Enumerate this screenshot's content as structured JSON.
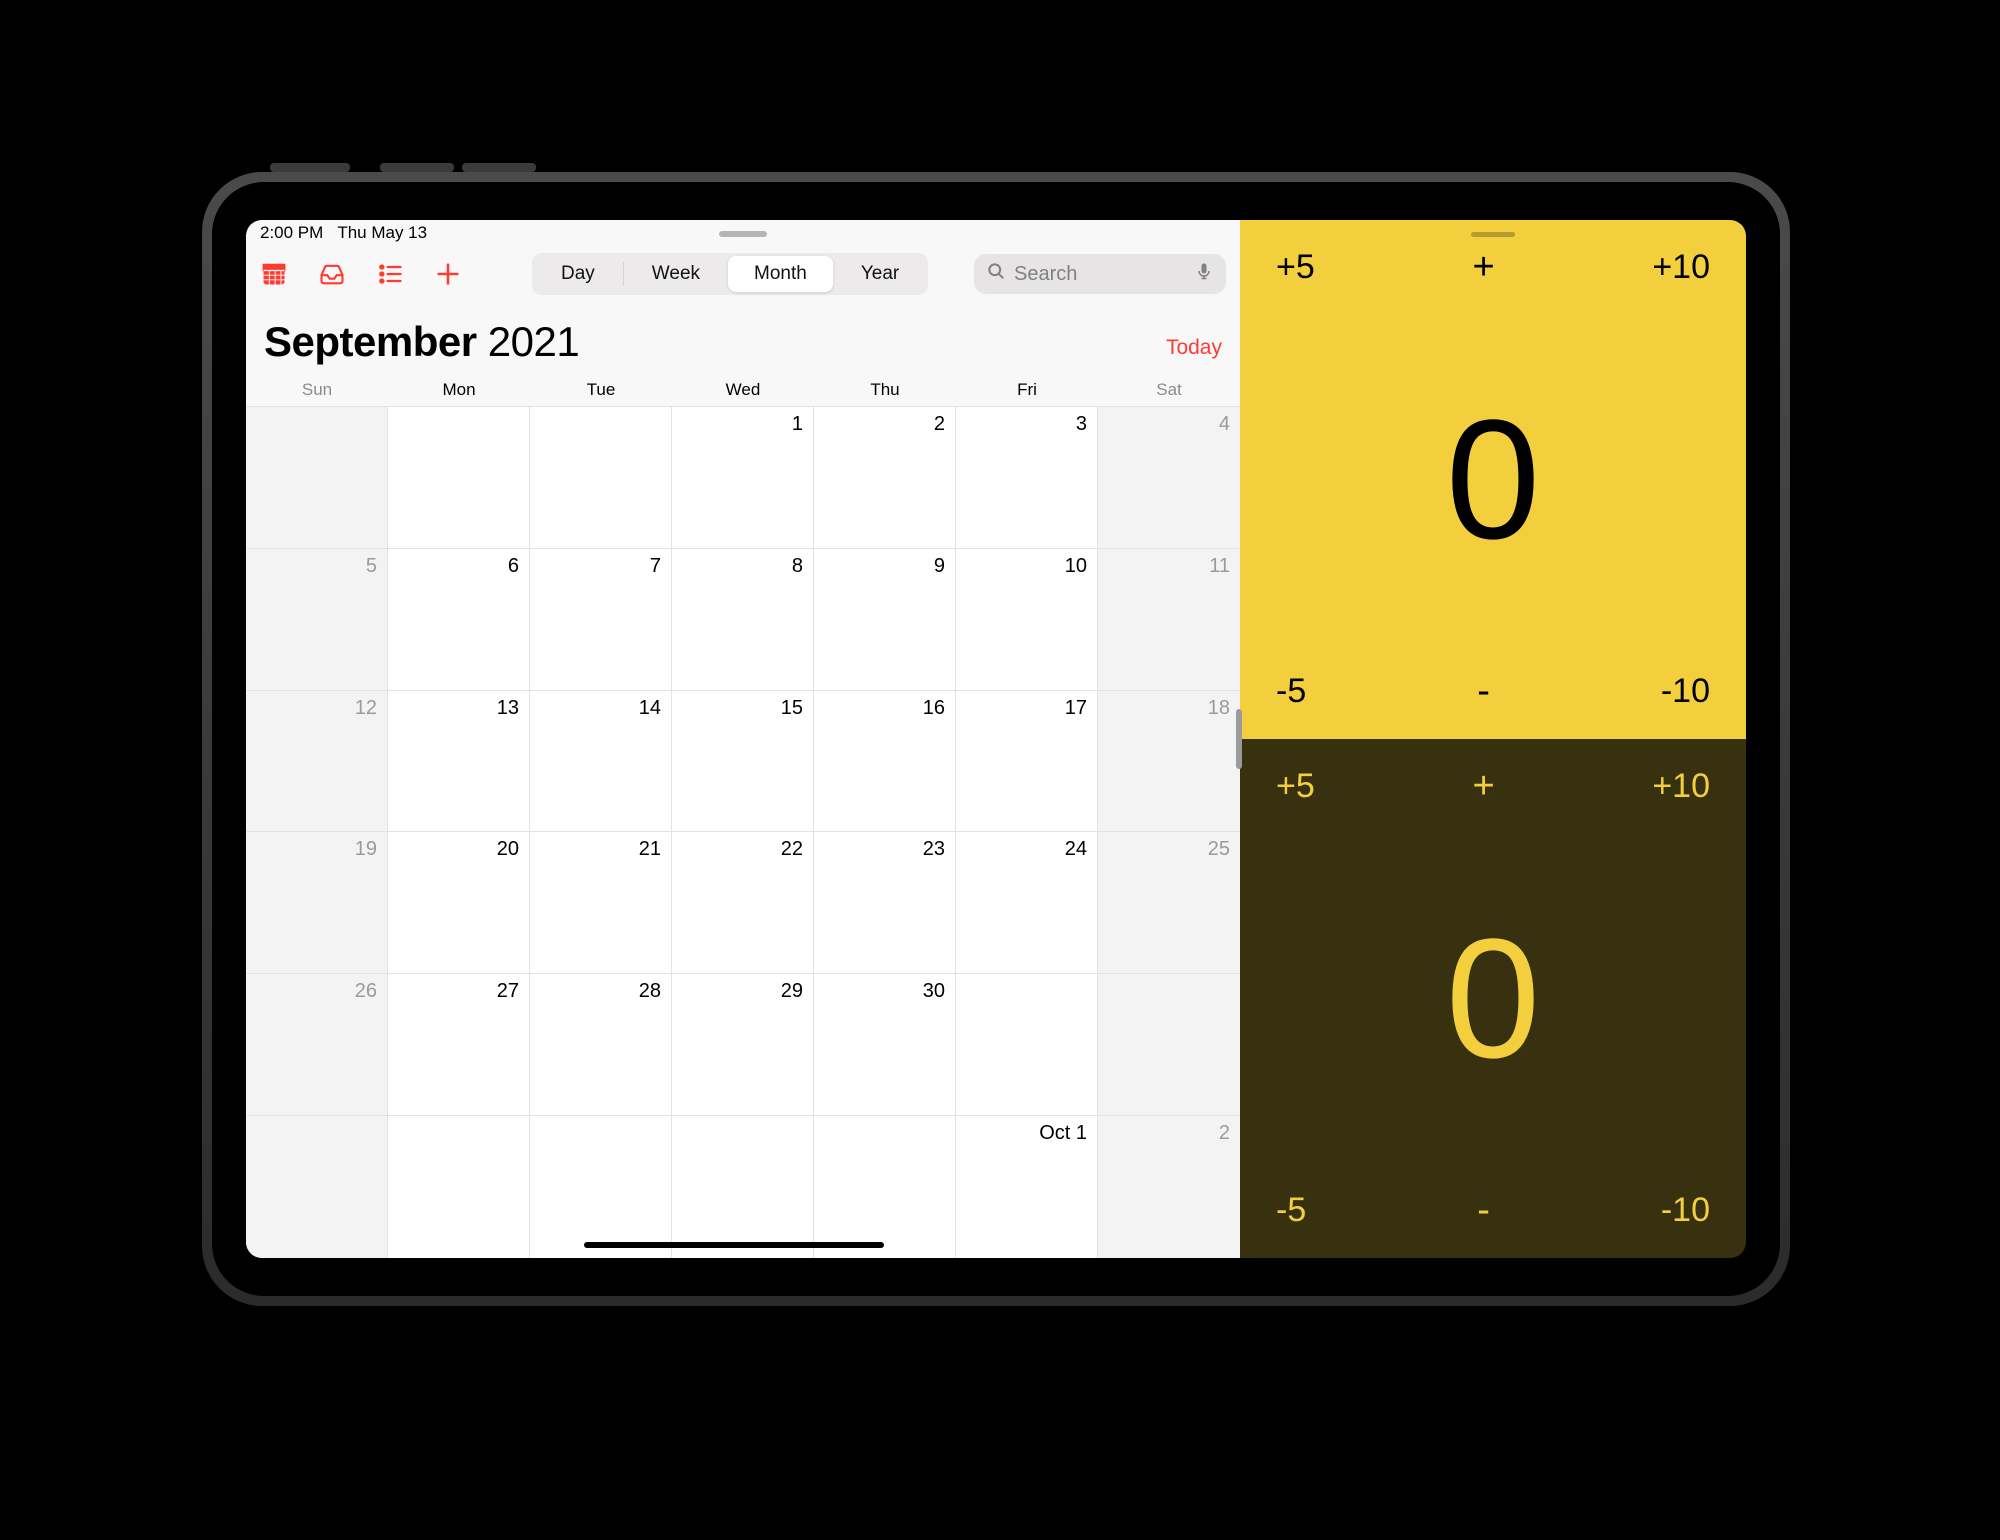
{
  "status": {
    "time": "2:00 PM",
    "date": "Thu May 13"
  },
  "toolbar": {
    "segments": {
      "day": "Day",
      "week": "Week",
      "month": "Month",
      "year": "Year",
      "selected": "Month"
    },
    "search_placeholder": "Search"
  },
  "header": {
    "month": "September",
    "year": "2021",
    "today_label": "Today"
  },
  "weekdays": [
    "Sun",
    "Mon",
    "Tue",
    "Wed",
    "Thu",
    "Fri",
    "Sat"
  ],
  "grid": [
    [
      {
        "t": "",
        "w": true
      },
      {
        "t": ""
      },
      {
        "t": ""
      },
      {
        "t": "1"
      },
      {
        "t": "2"
      },
      {
        "t": "3"
      },
      {
        "t": "4",
        "w": true
      }
    ],
    [
      {
        "t": "5",
        "w": true
      },
      {
        "t": "6"
      },
      {
        "t": "7"
      },
      {
        "t": "8"
      },
      {
        "t": "9"
      },
      {
        "t": "10"
      },
      {
        "t": "11",
        "w": true
      }
    ],
    [
      {
        "t": "12",
        "w": true
      },
      {
        "t": "13"
      },
      {
        "t": "14"
      },
      {
        "t": "15"
      },
      {
        "t": "16"
      },
      {
        "t": "17"
      },
      {
        "t": "18",
        "w": true
      }
    ],
    [
      {
        "t": "19",
        "w": true
      },
      {
        "t": "20"
      },
      {
        "t": "21"
      },
      {
        "t": "22"
      },
      {
        "t": "23"
      },
      {
        "t": "24"
      },
      {
        "t": "25",
        "w": true
      }
    ],
    [
      {
        "t": "26",
        "w": true
      },
      {
        "t": "27"
      },
      {
        "t": "28"
      },
      {
        "t": "29"
      },
      {
        "t": "30"
      },
      {
        "t": ""
      },
      {
        "t": "",
        "w": true
      }
    ],
    [
      {
        "t": "",
        "w": true
      },
      {
        "t": ""
      },
      {
        "t": ""
      },
      {
        "t": ""
      },
      {
        "t": ""
      },
      {
        "t": "Oct 1"
      },
      {
        "t": "2",
        "w": true
      }
    ]
  ],
  "counter": {
    "top": {
      "plus5": "+5",
      "plus": "+",
      "plus10": "+10",
      "value": "0",
      "minus5": "-5",
      "minus": "-",
      "minus10": "-10"
    },
    "bot": {
      "plus5": "+5",
      "plus": "+",
      "plus10": "+10",
      "value": "0",
      "minus5": "-5",
      "minus": "-",
      "minus10": "-10"
    }
  }
}
